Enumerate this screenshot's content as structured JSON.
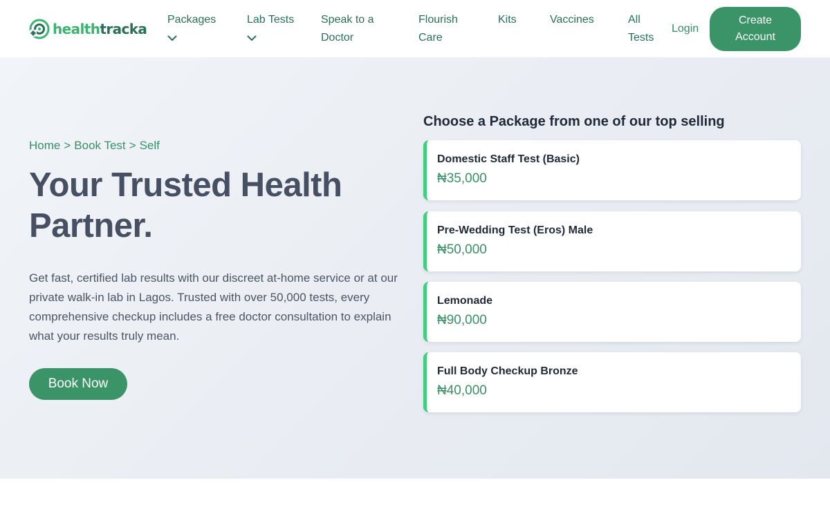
{
  "brand": {
    "logo_part1": "health",
    "logo_part2": "tracka",
    "colors": {
      "primary": "#3b9468",
      "accent": "#3fcf7f",
      "text_dark": "#475063"
    }
  },
  "nav": {
    "items": [
      {
        "label": "Packages",
        "has_dropdown": true
      },
      {
        "label": "Lab Tests",
        "has_dropdown": true
      },
      {
        "label": "Speak to a Doctor",
        "has_dropdown": false
      },
      {
        "label": "Flourish Care",
        "has_dropdown": false
      },
      {
        "label": "Kits",
        "has_dropdown": false
      },
      {
        "label": "Vaccines",
        "has_dropdown": false
      },
      {
        "label": "All Tests",
        "has_dropdown": false
      }
    ],
    "login_label": "Login",
    "create_account_label": "Create Account"
  },
  "hero": {
    "breadcrumb": [
      "Home",
      "Book Test",
      "Self"
    ],
    "breadcrumb_separator": ">",
    "title": "Your Trusted Health Partner.",
    "description": "Get fast, certified lab results with our discreet at-home service or at our private walk-in lab in Lagos. Trusted with over 50,000 tests, every comprehensive checkup includes a free doctor consultation to explain what your results truly mean.",
    "cta_label": "Book Now"
  },
  "packages": {
    "heading": "Choose a Package from one of our top selling",
    "items": [
      {
        "name": "Domestic Staff Test (Basic)",
        "price": "₦35,000"
      },
      {
        "name": "Pre-Wedding Test (Eros) Male",
        "price": "₦50,000"
      },
      {
        "name": "Lemonade",
        "price": "₦90,000"
      },
      {
        "name": "Full Body Checkup Bronze",
        "price": "₦40,000"
      }
    ]
  }
}
